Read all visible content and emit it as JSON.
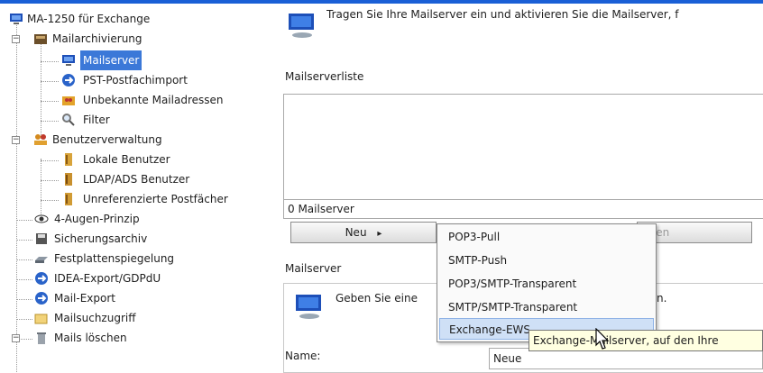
{
  "colors": {
    "accent": "#1a5fd6",
    "selection": "#3b78d8",
    "menu_highlight": "#cfe0f6",
    "tooltip_bg": "#ffffe1"
  },
  "tree": {
    "root": "MA-1250 für Exchange",
    "mailarchivierung": "Mailarchivierung",
    "mailserver": "Mailserver",
    "pst_import": "PST-Postfachimport",
    "unbekannte": "Unbekannte Mailadressen",
    "filter": "Filter",
    "benutzerverwaltung": "Benutzerverwaltung",
    "lokale_benutzer": "Lokale Benutzer",
    "ldap_benutzer": "LDAP/ADS Benutzer",
    "unreferenzierte": "Unreferenzierte Postfächer",
    "vier_augen": "4-Augen-Prinzip",
    "sicherungsarchiv": "Sicherungsarchiv",
    "festplattenspiegelung": "Festplattenspiegelung",
    "idea_export": "IDEA-Export/GDPdU",
    "mail_export": "Mail-Export",
    "mailsuchzugriff": "Mailsuchzugriff",
    "mails_loeschen": "Mails löschen"
  },
  "panel": {
    "intro": "Tragen Sie Ihre Mailserver ein und aktivieren Sie die Mailserver, f",
    "list_title": "Mailserverliste",
    "count": "0 Mailserver",
    "new_button": "Neu",
    "new_arrow": "▸",
    "hidden_button_text": "chen",
    "section_title": "Mailserver",
    "section_intro": "Geben Sie eine",
    "section_intro_tail": "n.",
    "name_label": "Name:",
    "name_value": "Neue"
  },
  "menu": {
    "items": [
      "POP3-Pull",
      "SMTP-Push",
      "POP3/SMTP-Transparent",
      "SMTP/SMTP-Transparent",
      "Exchange-EWS"
    ],
    "highlighted_index": 4
  },
  "tooltip": "Exchange-Mailserver, auf den Ihre"
}
